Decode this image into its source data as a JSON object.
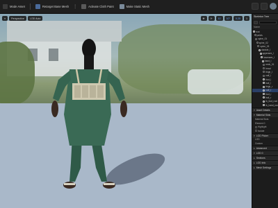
{
  "toolbar": {
    "scene_menu": "Mode Asset",
    "retarget": "Retarget Base Mesh",
    "activate_cloth": "Activate Cloth Paint",
    "make_static": "Make Static Mesh",
    "overflow": "⋮"
  },
  "viewport": {
    "perspective": "Perspective",
    "lod": "LOD Auto",
    "grid_value": "10",
    "angle_value": "10°",
    "scale_value": "0.25",
    "speed_value": "1"
  },
  "skeleton_tree": {
    "title": "Skeleton Tree",
    "column": "Name",
    "bones": [
      {
        "label": "root",
        "selected": false,
        "dim": false
      },
      {
        "label": "pelvis",
        "selected": false,
        "dim": true
      },
      {
        "label": "spine_01",
        "selected": false,
        "dim": true
      },
      {
        "label": "spine_02",
        "selected": false,
        "dim": true
      },
      {
        "label": "spine_03",
        "selected": false,
        "dim": true
      },
      {
        "label": "clavicle_l",
        "selected": false,
        "dim": false
      },
      {
        "label": "upperarm_l",
        "selected": false,
        "dim": false
      },
      {
        "label": "lowerarm_l",
        "selected": false,
        "dim": false
      },
      {
        "label": "hand_l",
        "selected": false,
        "dim": false
      },
      {
        "label": "neck_01",
        "selected": false,
        "dim": true
      },
      {
        "label": "head",
        "selected": false,
        "dim": true
      },
      {
        "label": "thigh_l",
        "selected": false,
        "dim": true
      },
      {
        "label": "calf_l",
        "selected": false,
        "dim": true
      },
      {
        "label": "foot_l",
        "selected": false,
        "dim": false
      },
      {
        "label": "ball_l",
        "selected": false,
        "dim": false
      },
      {
        "label": "thigh_r",
        "selected": false,
        "dim": false
      },
      {
        "label": "calf_r",
        "selected": true,
        "dim": false
      },
      {
        "label": "foot_r",
        "selected": false,
        "dim": false
      },
      {
        "label": "ball_r",
        "selected": false,
        "dim": false
      },
      {
        "label": "ik_foot_root",
        "selected": false,
        "dim": false
      },
      {
        "label": "ik_hand_root",
        "selected": false,
        "dim": false
      }
    ]
  },
  "asset_details": {
    "title": "Asset Details",
    "material_slots": "Material Slots",
    "material_slots_label": "Material Slots",
    "element": "Element 0",
    "highlight": "Highlight",
    "isolate": "Isolate",
    "lod_picker": "LOD Picker",
    "lod": "LOD",
    "custom": "Custom",
    "advanced": "Advanced",
    "lod0": "LOD 0",
    "sections": "Sections",
    "lod_info": "LOD Info",
    "mesh_settings": "Mesh Settings"
  },
  "colors": {
    "accent": "#2a3f66",
    "panel_bg": "#1c1c1c",
    "toolbar_bg": "#1f1f1f"
  }
}
